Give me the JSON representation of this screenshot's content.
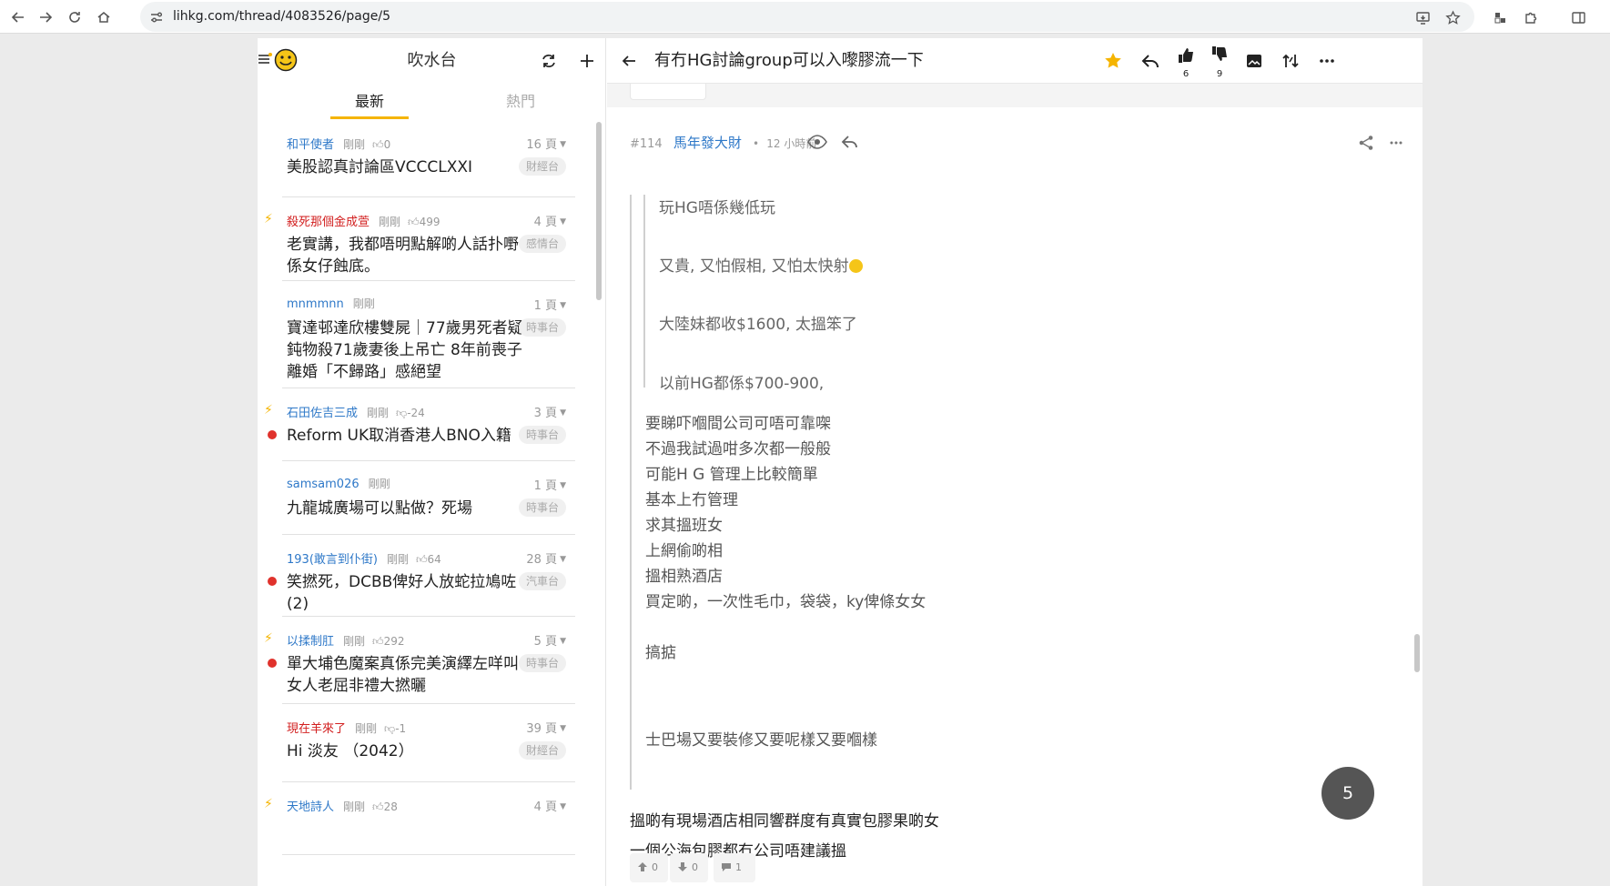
{
  "browser": {
    "url": "lihkg.com/thread/4083526/page/5"
  },
  "left": {
    "title": "吹水台",
    "tabs": [
      "最新",
      "熱門"
    ],
    "threads": [
      {
        "author": "和平使者",
        "author_red": false,
        "time": "剛剛",
        "likes": "0",
        "like_type": "up",
        "pages": "16 頁",
        "title": "美股認真討論區VCCCLXXI",
        "category": "財經台",
        "hot": false,
        "dot": false
      },
      {
        "author": "殺死那個金成萱",
        "author_red": true,
        "time": "剛剛",
        "likes": "499",
        "like_type": "up",
        "pages": "4 頁",
        "title": "老實講，我都唔明點解啲人話扑嘢係女仔蝕底。",
        "category": "感情台",
        "hot": true,
        "dot": false
      },
      {
        "author": "mnmmnn",
        "author_red": false,
        "time": "剛剛",
        "likes": "",
        "like_type": "none",
        "pages": "1 頁",
        "title": "寶達邨達欣樓雙屍｜77歲男死者疑鈍物殺71歲妻後上吊亡 8年前喪子離婚「不歸路」感絕望",
        "category": "時事台",
        "hot": false,
        "dot": false
      },
      {
        "author": "石田佐吉三成",
        "author_red": false,
        "time": "剛剛",
        "likes": "-24",
        "like_type": "down",
        "pages": "3 頁",
        "title": "Reform UK取消香港人BNO入籍",
        "category": "時事台",
        "hot": true,
        "dot": true
      },
      {
        "author": "samsam026",
        "author_red": false,
        "time": "剛剛",
        "likes": "",
        "like_type": "none",
        "pages": "1 頁",
        "title": "九龍城廣場可以點做？死場",
        "category": "時事台",
        "hot": false,
        "dot": false
      },
      {
        "author": "193(敢言到仆街)",
        "author_red": false,
        "time": "剛剛",
        "likes": "64",
        "like_type": "up",
        "pages": "28 頁",
        "title": "笑撚死，DCBB俾好人放蛇拉鳩咗(2)",
        "category": "汽車台",
        "hot": false,
        "dot": true
      },
      {
        "author": "以揉制肛",
        "author_red": false,
        "time": "剛剛",
        "likes": "292",
        "like_type": "up",
        "pages": "5 頁",
        "title": "單大埔色魔案真係完美演繹左咩叫女人老屈非禮大撚曬",
        "category": "時事台",
        "hot": true,
        "dot": true
      },
      {
        "author": "現在羊來了",
        "author_red": true,
        "time": "剛剛",
        "likes": "-1",
        "like_type": "down",
        "pages": "39 頁",
        "title": "Hi 淡友 （2042）",
        "category": "財經台",
        "hot": false,
        "dot": false
      },
      {
        "author": "天地詩人",
        "author_red": false,
        "time": "剛剛",
        "likes": "28",
        "like_type": "up",
        "pages": "4 頁",
        "title": "",
        "category": "",
        "hot": true,
        "dot": false
      }
    ]
  },
  "right": {
    "title": "有冇HG討論group可以入嚟膠流一下",
    "likes": "6",
    "dislikes": "9",
    "post": {
      "number": "#114",
      "author": "馬年發大財",
      "time": "12 小時前",
      "quote_lines": [
        "玩HG唔係幾低玩",
        "又貴, 又怕假相, 又怕太快射",
        "大陸妹都收$1600, 太搵笨了",
        "以前HG都係$700-900,"
      ],
      "inner_lines": [
        "要睇吓嗰間公司可唔可靠㗎",
        "不過我試過咁多次都一般般",
        "可能H G 管理上比較簡單",
        "基本上冇管理",
        "求其搵班女",
        "上網偷啲相",
        "搵相熟酒店",
        "買定啲，一次性毛巾，袋袋，ky俾條女女",
        "搞掂",
        "士巴場又要裝修又要呢樣又要嗰樣"
      ],
      "body_lines": [
        "搵啲有現場酒店相同響群度有真實包膠果啲女",
        "一個公海包膠都冇公司唔建議搵"
      ],
      "upvotes": "0",
      "downvotes": "0",
      "comments": "1"
    },
    "page_badge": "5"
  }
}
